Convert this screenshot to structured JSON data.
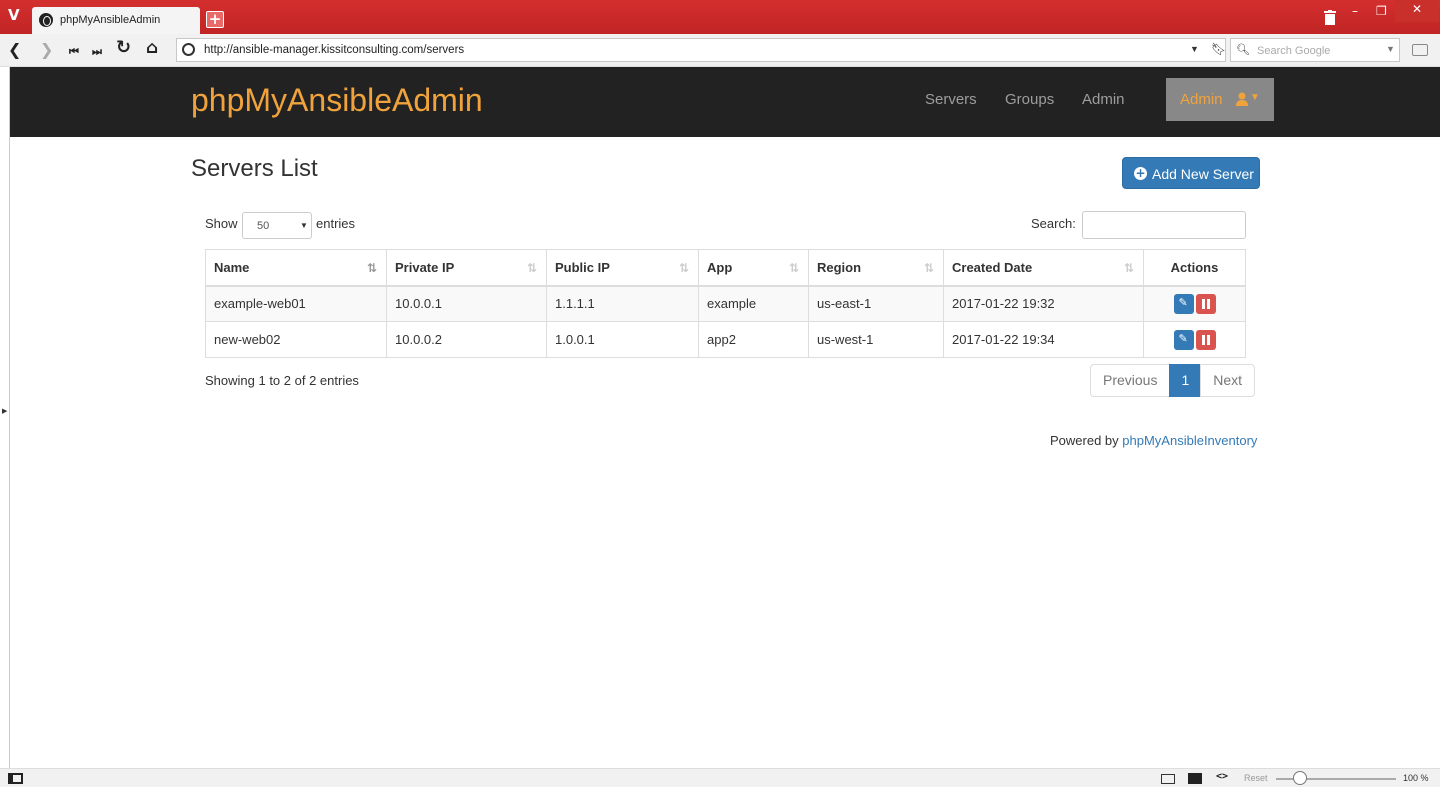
{
  "browser": {
    "tab_title": "phpMyAnsibleAdmin",
    "url": "http://ansible-manager.kissitconsulting.com/servers",
    "search_placeholder": "Search Google",
    "status": {
      "reset_label": "Reset",
      "zoom": "100 %",
      "zoom_percent": 100
    }
  },
  "app": {
    "brand": "phpMyAnsibleAdmin",
    "brand_color": "#f0a33c",
    "nav": {
      "servers": "Servers",
      "groups": "Groups",
      "admin": "Admin"
    },
    "user_menu": "Admin"
  },
  "page": {
    "title": "Servers List",
    "add_button": "Add New Server",
    "show_label": "Show",
    "page_length": "50",
    "entries_label": "entries",
    "search_label": "Search:",
    "columns": {
      "name": "Name",
      "private_ip": "Private IP",
      "public_ip": "Public IP",
      "app": "App",
      "region": "Region",
      "created": "Created Date",
      "actions": "Actions"
    },
    "rows": [
      {
        "name": "example-web01",
        "private_ip": "10.0.0.1",
        "public_ip": "1.1.1.1",
        "app": "example",
        "region": "us-east-1",
        "created": "2017-01-22 19:32"
      },
      {
        "name": "new-web02",
        "private_ip": "10.0.0.2",
        "public_ip": "1.0.0.1",
        "app": "app2",
        "region": "us-west-1",
        "created": "2017-01-22 19:34"
      }
    ],
    "info": "Showing 1 to 2 of 2 entries",
    "pagination": {
      "previous": "Previous",
      "current": "1",
      "next": "Next"
    },
    "footer": {
      "prefix": "Powered by",
      "link": "phpMyAnsibleInventory"
    }
  }
}
